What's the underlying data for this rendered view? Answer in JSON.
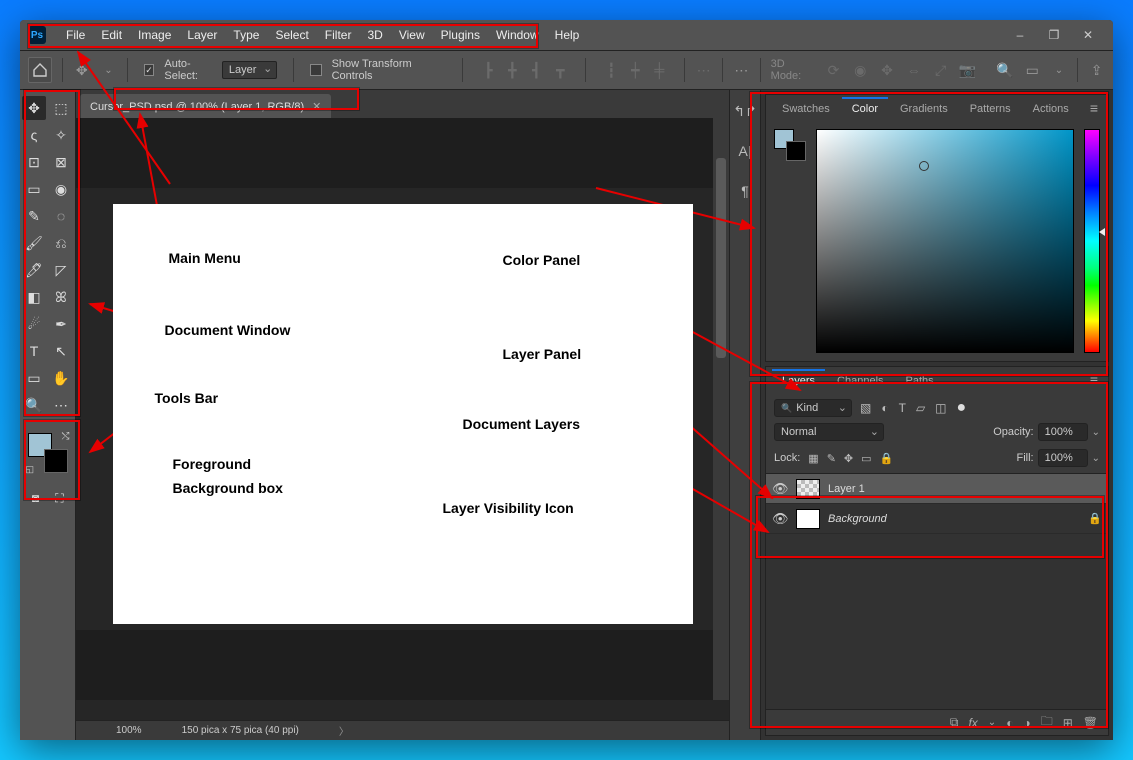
{
  "menu": {
    "items": [
      "File",
      "Edit",
      "Image",
      "Layer",
      "Type",
      "Select",
      "Filter",
      "3D",
      "View",
      "Plugins",
      "Window",
      "Help"
    ]
  },
  "window_controls": {
    "min": "–",
    "restore": "❐",
    "close": "✕"
  },
  "options": {
    "auto_select_label": "Auto-Select:",
    "target": "Layer",
    "show_transform": "Show Transform Controls",
    "three_d_label": "3D Mode:"
  },
  "doc_tab": {
    "title": "Cursor_PSD.psd @ 100% (Layer 1, RGB/8)"
  },
  "status": {
    "zoom": "100%",
    "doc": "150 pica x 75 pica (40 ppi)"
  },
  "color_panel": {
    "tabs": [
      "Swatches",
      "Color",
      "Gradients",
      "Patterns",
      "Actions"
    ],
    "active": 1
  },
  "layers_panel": {
    "tabs": [
      "Layers",
      "Channels",
      "Paths"
    ],
    "active": 0,
    "kind": "Kind",
    "blend": "Normal",
    "opacity_label": "Opacity:",
    "opacity_value": "100%",
    "lock_label": "Lock:",
    "fill_label": "Fill:",
    "fill_value": "100%",
    "layers": [
      {
        "name": "Layer 1",
        "selected": true,
        "thumb": "checker",
        "italic": false,
        "locked": false
      },
      {
        "name": "Background",
        "selected": false,
        "thumb": "white",
        "italic": true,
        "locked": true
      }
    ]
  },
  "annotations": {
    "main_menu": "Main Menu",
    "document_window": "Document Window",
    "tools_bar": "Tools Bar",
    "fgbg": "Foreground",
    "fgbg2": "Background box",
    "color_panel": "Color Panel",
    "layer_panel": "Layer Panel",
    "doc_layers": "Document Layers",
    "layer_vis": "Layer Visibility Icon"
  },
  "colors": {
    "foreground": "#a1c4d5",
    "background": "#000000"
  }
}
